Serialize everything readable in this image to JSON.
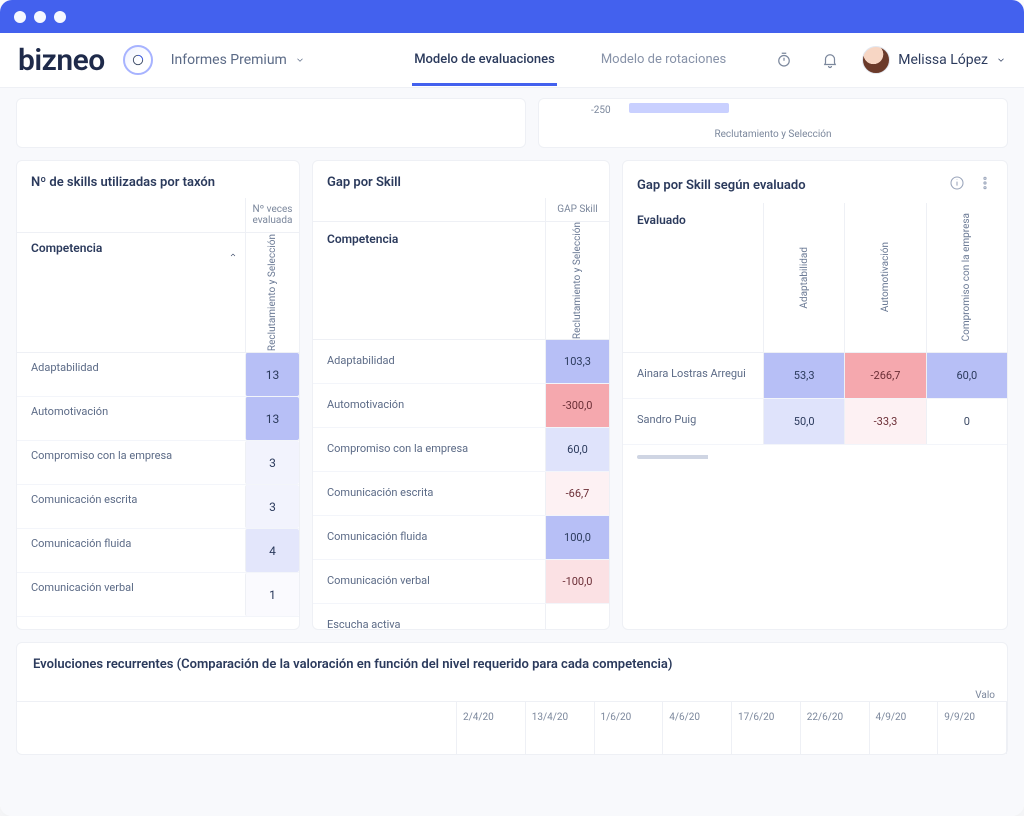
{
  "brand": "bizneo",
  "nav": {
    "premium_dd": "Informes Premium",
    "tab_eval": "Modelo de evaluaciones",
    "tab_rot": "Modelo de rotaciones",
    "user_name": "Melissa López"
  },
  "partial_chart": {
    "tick": "-250",
    "axis_label": "Reclutamiento y Selección"
  },
  "card1": {
    "title": "Nº de skills utilizadas por taxón",
    "col_times_1": "Nº veces",
    "col_times_2": "evaluada",
    "row_header": "Competencia",
    "vertical_label": "Reclutamiento y Selección",
    "rows": [
      {
        "label": "Adaptabilidad",
        "count": "13",
        "heat": "heat-hi"
      },
      {
        "label": "Automotivación",
        "count": "13",
        "heat": "heat-hi"
      },
      {
        "label": "Compromiso con la empresa",
        "count": "3",
        "heat": "heat-lo"
      },
      {
        "label": "Comunicación escrita",
        "count": "3",
        "heat": "heat-lo"
      },
      {
        "label": "Comunicación fluida",
        "count": "4",
        "heat": "heat-md"
      },
      {
        "label": "Comunicación verbal",
        "count": "1",
        "heat": "heat-vl"
      }
    ]
  },
  "card2": {
    "title": "Gap por Skill",
    "gap_label": "GAP Skill",
    "row_header": "Competencia",
    "vertical_label": "Reclutamiento y Selección",
    "rows": [
      {
        "label": "Adaptabilidad",
        "value": "103,3",
        "cls": "pos1"
      },
      {
        "label": "Automotivación",
        "value": "-300,0",
        "cls": "neg1"
      },
      {
        "label": "Compromiso con la empresa",
        "value": "60,0",
        "cls": "pos2"
      },
      {
        "label": "Comunicación escrita",
        "value": "-66,7",
        "cls": "neg3"
      },
      {
        "label": "Comunicación fluida",
        "value": "100,0",
        "cls": "pos1"
      },
      {
        "label": "Comunicación verbal",
        "value": "-100,0",
        "cls": "neg2"
      },
      {
        "label": "Escucha activa",
        "value": "",
        "cls": ""
      }
    ]
  },
  "card3": {
    "title": "Gap por Skill según evaluado",
    "row_header": "Evaluado",
    "cols": [
      "Adaptabilidad",
      "Automotivación",
      "Compromiso con la empresa"
    ],
    "rows": [
      {
        "label": "Ainara Lostras Arregui",
        "cells": [
          {
            "v": "53,3",
            "cls": "pos1"
          },
          {
            "v": "-266,7",
            "cls": "neg1"
          },
          {
            "v": "60,0",
            "cls": "pos1"
          }
        ]
      },
      {
        "label": "Sandro Puig",
        "cells": [
          {
            "v": "50,0",
            "cls": "pos2"
          },
          {
            "v": "-33,3",
            "cls": "neg3"
          },
          {
            "v": "0",
            "cls": ""
          }
        ]
      }
    ]
  },
  "bottom": {
    "title": "Evoluciones recurrentes (Comparación de la valoración en función del nivel requerido para cada competencia)",
    "value_hdr": "Valo",
    "dates": [
      "2/4/20",
      "13/4/20",
      "1/6/20",
      "4/6/20",
      "17/6/20",
      "22/6/20",
      "4/9/20",
      "9/9/20"
    ]
  }
}
